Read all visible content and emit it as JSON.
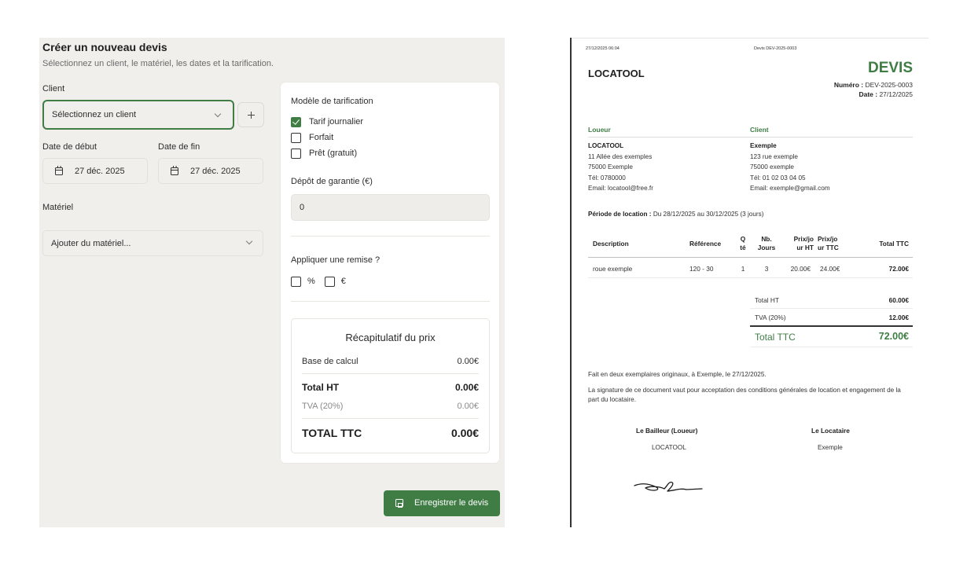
{
  "form": {
    "title": "Créer un nouveau devis",
    "subtitle": "Sélectionnez un client, le matériel, les dates et la tarification.",
    "client_label": "Client",
    "client_placeholder": "Sélectionnez un client",
    "start_date_label": "Date de début",
    "start_date_value": "27 déc. 2025",
    "end_date_label": "Date de fin",
    "end_date_value": "27 déc. 2025",
    "materiel_label": "Matériel",
    "materiel_placeholder": "Ajouter du matériel...",
    "save_label": "Enregistrer le devis"
  },
  "pricing": {
    "model_label": "Modèle de tarification",
    "options": [
      {
        "label": "Tarif journalier",
        "checked": true
      },
      {
        "label": "Forfait",
        "checked": false
      },
      {
        "label": "Prêt (gratuit)",
        "checked": false
      }
    ],
    "deposit_label": "Dépôt de garantie (€)",
    "deposit_value": "0",
    "discount_label": "Appliquer une remise ?",
    "discount_percent": "%",
    "discount_euro": "€"
  },
  "summary": {
    "title": "Récapitulatif du prix",
    "base_label": "Base de calcul",
    "base_value": "0.00€",
    "total_ht_label": "Total HT",
    "total_ht_value": "0.00€",
    "tva_label": "TVA (20%)",
    "tva_value": "0.00€",
    "total_ttc_label": "TOTAL TTC",
    "total_ttc_value": "0.00€"
  },
  "doc": {
    "print_date": "27/12/2025 06:04",
    "print_title": "Devis DEV-2025-0003",
    "brand": "LOCATOOL",
    "devis_title": "DEVIS",
    "numero_label": "Numéro :",
    "numero_value": "DEV-2025-0003",
    "date_label": "Date :",
    "date_value": "27/12/2025",
    "loueur_heading": "Loueur",
    "loueur_lines": [
      "LOCATOOL",
      "11 Allée des exemples",
      "75000 Exemple",
      "Tél: 0780000",
      "Email: locatool@free.fr"
    ],
    "client_heading": "Client",
    "client_lines": [
      "Exemple",
      "123 rue exemple",
      "75000 exemple",
      "Tél: 01 02 03 04 05",
      "Email: exemple@gmail.com"
    ],
    "period_label": "Période de location :",
    "period_value": "Du 28/12/2025 au 30/12/2025 (3 jours)",
    "table_headers": [
      "Description",
      "Référence",
      "Q\nté",
      "Nb.\nJours",
      "Prix/jo\nur HT",
      "Prix/jo\nur TTC",
      "Total TTC"
    ],
    "table_rows": [
      [
        "roue exemple",
        "120 - 30",
        "1",
        "3",
        "20.00€",
        "24.00€",
        "72.00€"
      ]
    ],
    "total_ht_label": "Total HT",
    "total_ht_value": "60.00€",
    "tva_label": "TVA (20%)",
    "tva_value": "12.00€",
    "total_ttc_label": "Total TTC",
    "total_ttc_value": "72.00€",
    "fait_text": "Fait en deux exemplaires originaux, à Exemple, le 27/12/2025.",
    "signature_text": "La signature de ce document vaut pour acceptation des conditions générales de location et engagement de la part du locataire.",
    "bailleur_label": "Le Bailleur (Loueur)",
    "bailleur_name": "LOCATOOL",
    "locataire_label": "Le Locataire",
    "locataire_name": "Exemple"
  },
  "colors": {
    "accent": "#3f7d45",
    "panel_bg": "#f0efec"
  }
}
